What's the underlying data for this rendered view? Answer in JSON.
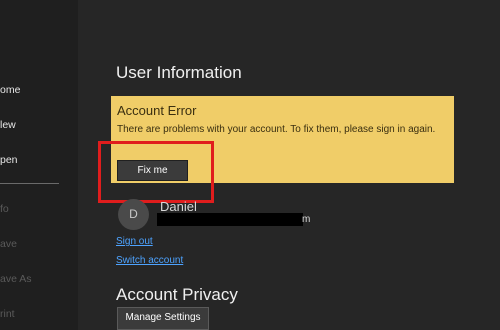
{
  "sidebar": {
    "items": [
      {
        "label": "ome",
        "enabled": true
      },
      {
        "label": "lew",
        "enabled": true
      },
      {
        "label": "pen",
        "enabled": true
      },
      {
        "label": "fo",
        "enabled": false
      },
      {
        "label": "ave",
        "enabled": false
      },
      {
        "label": "ave As",
        "enabled": false
      },
      {
        "label": "rint",
        "enabled": false
      }
    ]
  },
  "main": {
    "user_info_heading": "User Information",
    "error": {
      "title": "Account Error",
      "message": "There are problems with your account. To fix them, please sign in again.",
      "fix_button": "Fix me"
    },
    "user": {
      "avatar_initial": "D",
      "name": "Daniel",
      "email_tail": "m"
    },
    "links": {
      "sign_out": "Sign out",
      "switch_account": "Switch account"
    },
    "privacy_heading": "Account Privacy",
    "manage_settings_button": "Manage Settings"
  },
  "colors": {
    "sidebar_bg": "#1f1f1f",
    "main_bg": "#262626",
    "banner_bg": "#f0cd68",
    "highlight": "#e01d1d",
    "link": "#4da3ff"
  }
}
